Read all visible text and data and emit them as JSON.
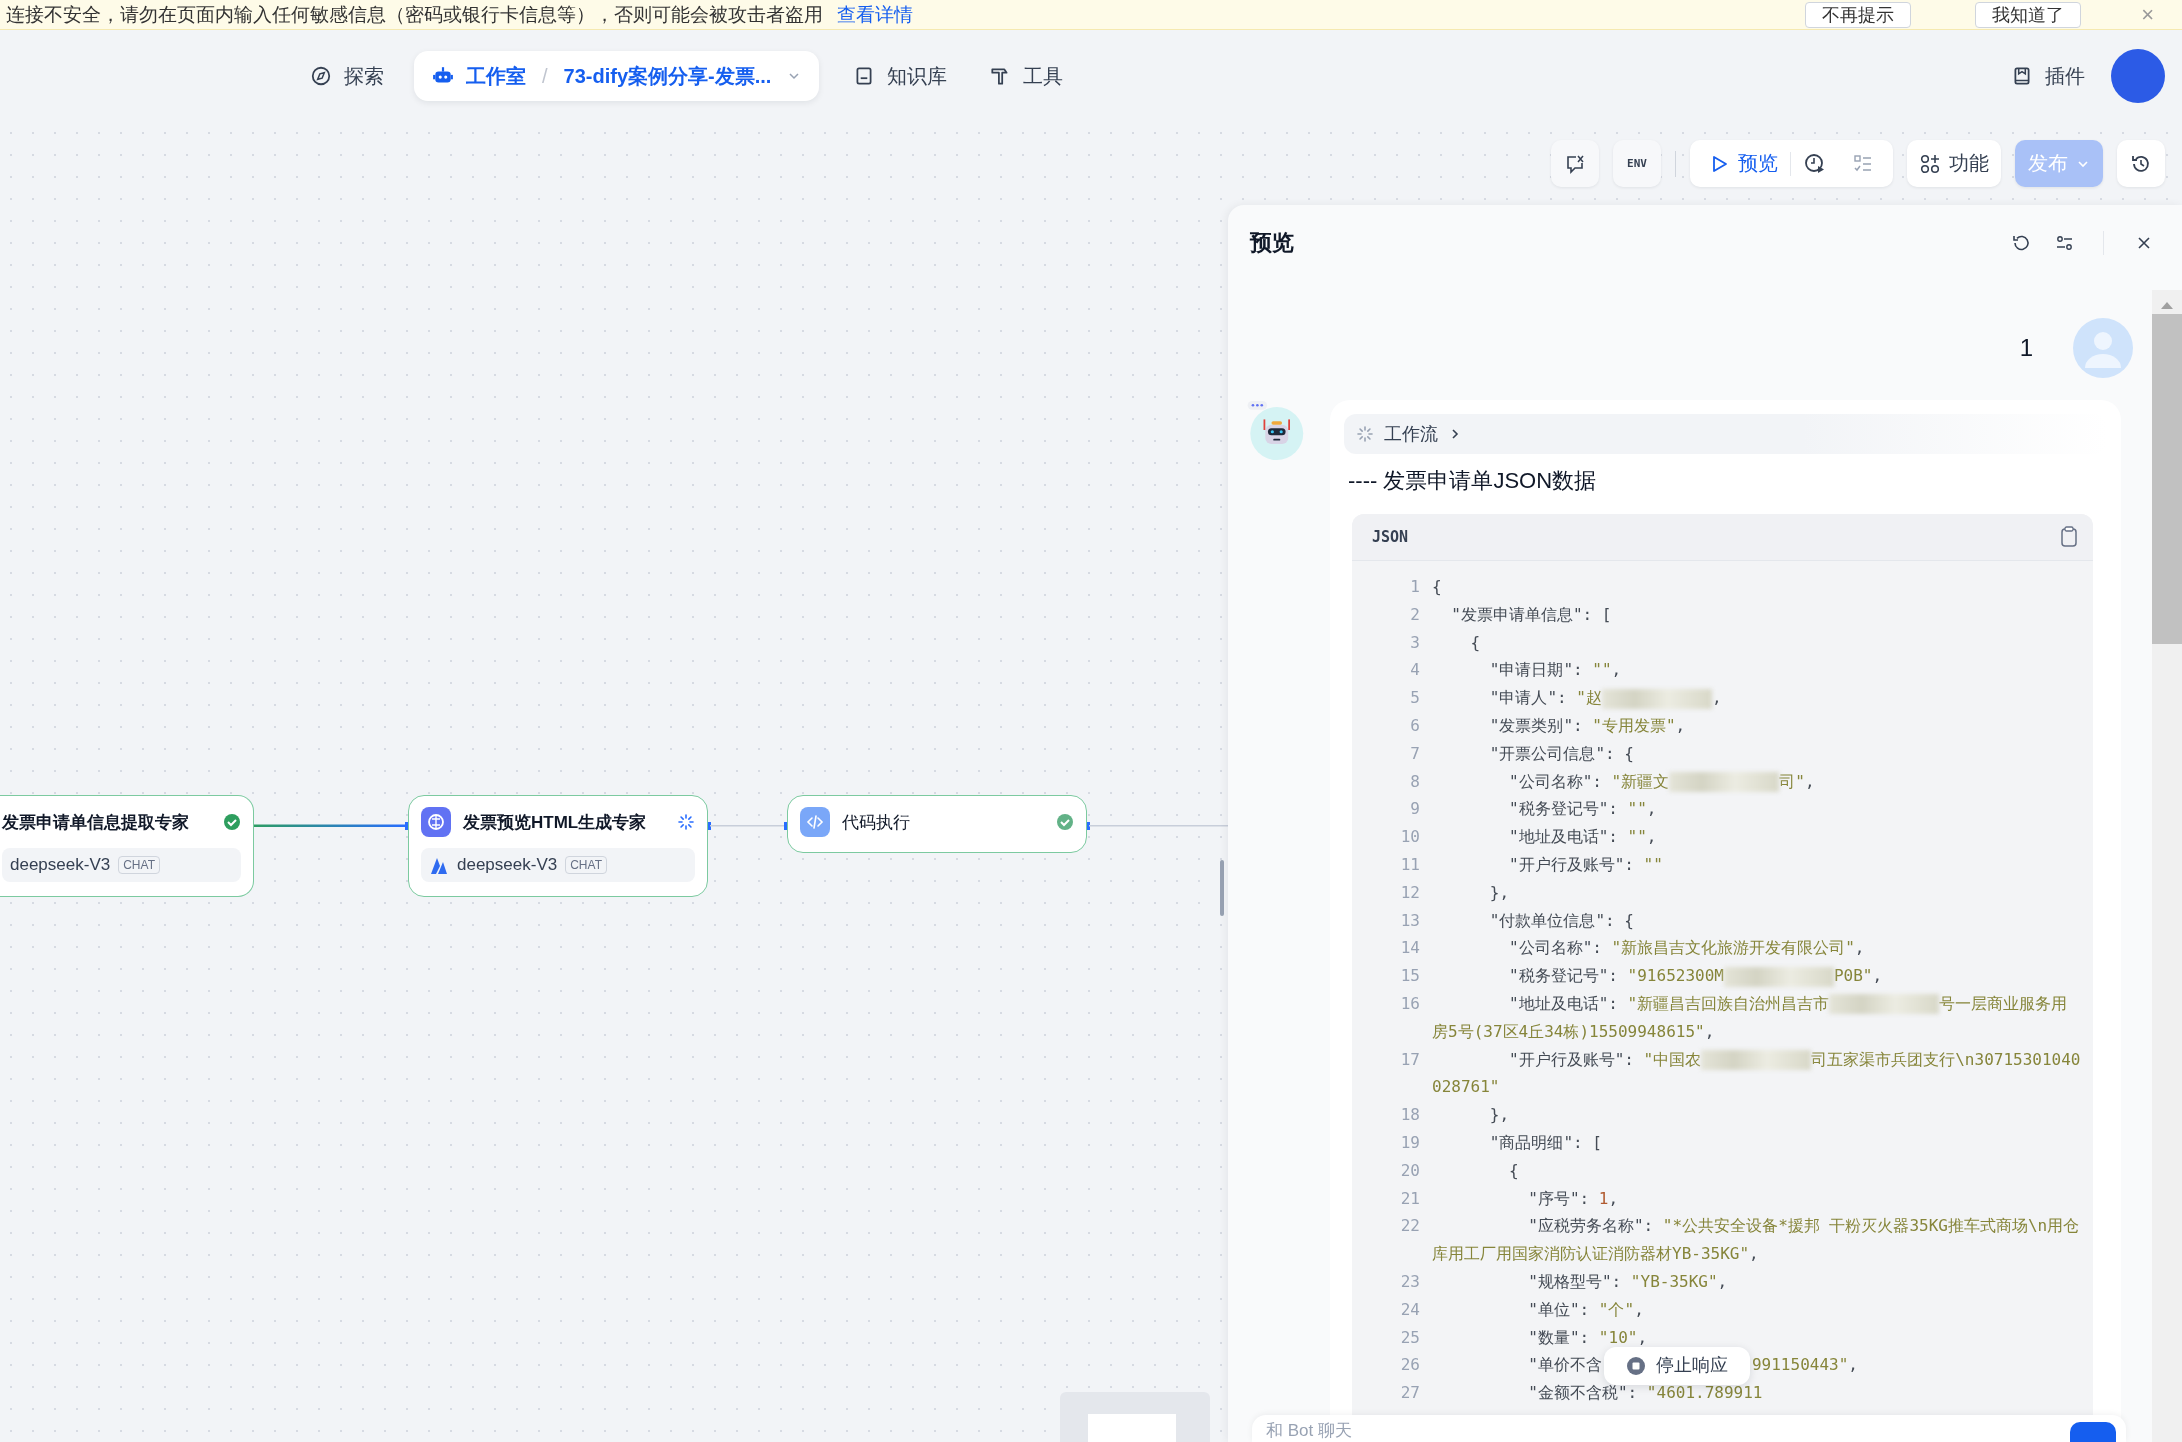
{
  "banner": {
    "message": "连接不安全，请勿在页面内输入任何敏感信息（密码或银行卡信息等），否则可能会被攻击者盗用",
    "link": "查看详情",
    "buttons": [
      "不再提示",
      "我知道了"
    ],
    "close": "×"
  },
  "nav": {
    "items": [
      {
        "label": "探索",
        "selected": false
      },
      {
        "label": "工作室",
        "selected": true,
        "separator": "/",
        "breadcrumb": "73-dify案例分享-发票..."
      },
      {
        "label": "知识库",
        "selected": false
      },
      {
        "label": "工具",
        "selected": false
      }
    ],
    "plugins": "插件"
  },
  "toolbar": {
    "env": "ENV",
    "preview": "预览",
    "features": "功能",
    "publish": {
      "label": "发布",
      "disabled": true
    }
  },
  "canvas": {
    "nodes": [
      {
        "title": "发票申请单信息提取专家",
        "model": "deepseek-V3",
        "badge": "CHAT",
        "running": false,
        "kind": "llm"
      },
      {
        "title": "发票预览HTML生成专家",
        "model": "deepseek-V3",
        "badge": "CHAT",
        "running": true,
        "kind": "llm"
      },
      {
        "title": "代码执行",
        "running": false,
        "kind": "code"
      }
    ]
  },
  "preview": {
    "title": "预览",
    "user_message": "1",
    "workflow": "工作流",
    "heading": "---- 发票申请单JSON数据",
    "stop_button": "停止响应",
    "input": {
      "placeholder": "和 Bot 聊天"
    },
    "code": {
      "language": "JSON",
      "lines": [
        {
          "number": "1",
          "segments": [
            {
              "kind": "punct",
              "text": "{"
            }
          ]
        },
        {
          "number": "2",
          "segments": [
            {
              "kind": "key",
              "text": "  \"发票申请单信息\""
            },
            {
              "kind": "punct",
              "text": ": ["
            }
          ]
        },
        {
          "number": "3",
          "segments": [
            {
              "kind": "punct",
              "text": "    {"
            }
          ]
        },
        {
          "number": "4",
          "segments": [
            {
              "kind": "key",
              "text": "      \"申请日期\""
            },
            {
              "kind": "punct",
              "text": ": "
            },
            {
              "kind": "string",
              "text": "\"\""
            },
            {
              "kind": "punct",
              "text": ","
            }
          ]
        },
        {
          "number": "5",
          "segments": [
            {
              "kind": "key",
              "text": "      \"申请人\""
            },
            {
              "kind": "punct",
              "text": ": "
            },
            {
              "kind": "string",
              "text": "\"赵"
            },
            {
              "kind": "redacted"
            },
            {
              "kind": "punct",
              "text": ","
            }
          ]
        },
        {
          "number": "6",
          "segments": [
            {
              "kind": "key",
              "text": "      \"发票类别\""
            },
            {
              "kind": "punct",
              "text": ": "
            },
            {
              "kind": "string",
              "text": "\"专用发票\""
            },
            {
              "kind": "punct",
              "text": ","
            }
          ]
        },
        {
          "number": "7",
          "segments": [
            {
              "kind": "key",
              "text": "      \"开票公司信息\""
            },
            {
              "kind": "punct",
              "text": ": {"
            }
          ]
        },
        {
          "number": "8",
          "segments": [
            {
              "kind": "key",
              "text": "        \"公司名称\""
            },
            {
              "kind": "punct",
              "text": ": "
            },
            {
              "kind": "string",
              "text": "\"新疆文"
            },
            {
              "kind": "redacted"
            },
            {
              "kind": "string",
              "text": "司\""
            },
            {
              "kind": "punct",
              "text": ","
            }
          ]
        },
        {
          "number": "9",
          "segments": [
            {
              "kind": "key",
              "text": "        \"税务登记号\""
            },
            {
              "kind": "punct",
              "text": ": "
            },
            {
              "kind": "string",
              "text": "\"\""
            },
            {
              "kind": "punct",
              "text": ","
            }
          ]
        },
        {
          "number": "10",
          "segments": [
            {
              "kind": "key",
              "text": "        \"地址及电话\""
            },
            {
              "kind": "punct",
              "text": ": "
            },
            {
              "kind": "string",
              "text": "\"\""
            },
            {
              "kind": "punct",
              "text": ","
            }
          ]
        },
        {
          "number": "11",
          "segments": [
            {
              "kind": "key",
              "text": "        \"开户行及账号\""
            },
            {
              "kind": "punct",
              "text": ": "
            },
            {
              "kind": "string",
              "text": "\"\""
            }
          ]
        },
        {
          "number": "12",
          "segments": [
            {
              "kind": "punct",
              "text": "      },"
            }
          ]
        },
        {
          "number": "13",
          "segments": [
            {
              "kind": "key",
              "text": "      \"付款单位信息\""
            },
            {
              "kind": "punct",
              "text": ": {"
            }
          ]
        },
        {
          "number": "14",
          "segments": [
            {
              "kind": "key",
              "text": "        \"公司名称\""
            },
            {
              "kind": "punct",
              "text": ": "
            },
            {
              "kind": "string",
              "text": "\"新旅昌吉文化旅游开发有限公司\""
            },
            {
              "kind": "punct",
              "text": ","
            }
          ]
        },
        {
          "number": "15",
          "segments": [
            {
              "kind": "key",
              "text": "        \"税务登记号\""
            },
            {
              "kind": "punct",
              "text": ": "
            },
            {
              "kind": "string",
              "text": "\"91652300M"
            },
            {
              "kind": "redacted"
            },
            {
              "kind": "string",
              "text": "P0B\""
            },
            {
              "kind": "punct",
              "text": ","
            }
          ]
        },
        {
          "number": "16",
          "segments": [
            {
              "kind": "key",
              "text": "        \"地址及电话\""
            },
            {
              "kind": "punct",
              "text": ": "
            },
            {
              "kind": "string",
              "text": "\"新疆昌吉回族自治州昌吉市"
            },
            {
              "kind": "redacted"
            },
            {
              "kind": "string",
              "text": "号一层商业服务用房5号(37区4丘34栋)15509948615\""
            },
            {
              "kind": "punct",
              "text": ","
            }
          ]
        },
        {
          "number": "17",
          "segments": [
            {
              "kind": "key",
              "text": "        \"开户行及账号\""
            },
            {
              "kind": "punct",
              "text": ": "
            },
            {
              "kind": "string",
              "text": "\"中国农"
            },
            {
              "kind": "redacted"
            },
            {
              "kind": "string",
              "text": "司五家渠市兵团支行\\n30715301040028761\""
            }
          ]
        },
        {
          "number": "18",
          "segments": [
            {
              "kind": "punct",
              "text": "      },"
            }
          ]
        },
        {
          "number": "19",
          "segments": [
            {
              "kind": "key",
              "text": "      \"商品明细\""
            },
            {
              "kind": "punct",
              "text": ": ["
            }
          ]
        },
        {
          "number": "20",
          "segments": [
            {
              "kind": "punct",
              "text": "        {"
            }
          ]
        },
        {
          "number": "21",
          "segments": [
            {
              "kind": "key",
              "text": "          \"序号\""
            },
            {
              "kind": "punct",
              "text": ": "
            },
            {
              "kind": "number",
              "text": "1"
            },
            {
              "kind": "punct",
              "text": ","
            }
          ]
        },
        {
          "number": "22",
          "segments": [
            {
              "kind": "key",
              "text": "          \"应税劳务名称\""
            },
            {
              "kind": "punct",
              "text": ": "
            },
            {
              "kind": "string",
              "text": "\"*公共安全设备*援邦 干粉灭火器35KG推车式商场\\n用仓库用工厂用国家消防认证消防器材YB-35KG\""
            },
            {
              "kind": "punct",
              "text": ","
            }
          ]
        },
        {
          "number": "23",
          "segments": [
            {
              "kind": "key",
              "text": "          \"规格型号\""
            },
            {
              "kind": "punct",
              "text": ": "
            },
            {
              "kind": "string",
              "text": "\"YB-35KG\""
            },
            {
              "kind": "punct",
              "text": ","
            }
          ]
        },
        {
          "number": "24",
          "segments": [
            {
              "kind": "key",
              "text": "          \"单位\""
            },
            {
              "kind": "punct",
              "text": ": "
            },
            {
              "kind": "string",
              "text": "\"个\""
            },
            {
              "kind": "punct",
              "text": ","
            }
          ]
        },
        {
          "number": "25",
          "segments": [
            {
              "kind": "key",
              "text": "          \"数量\""
            },
            {
              "kind": "punct",
              "text": ": "
            },
            {
              "kind": "string",
              "text": "\"10\""
            },
            {
              "kind": "punct",
              "text": ","
            }
          ]
        },
        {
          "number": "26",
          "segments": [
            {
              "kind": "key",
              "text": "          \"单价不含"
            },
            {
              "kind": "gap"
            },
            {
              "kind": "string",
              "text": "991150443\""
            },
            {
              "kind": "punct",
              "text": ","
            }
          ]
        },
        {
          "number": "27",
          "segments": [
            {
              "kind": "key",
              "text": "          \"金额不含税\""
            },
            {
              "kind": "punct",
              "text": ": "
            },
            {
              "kind": "string",
              "text": "\"4601.789911"
            }
          ]
        }
      ]
    }
  }
}
